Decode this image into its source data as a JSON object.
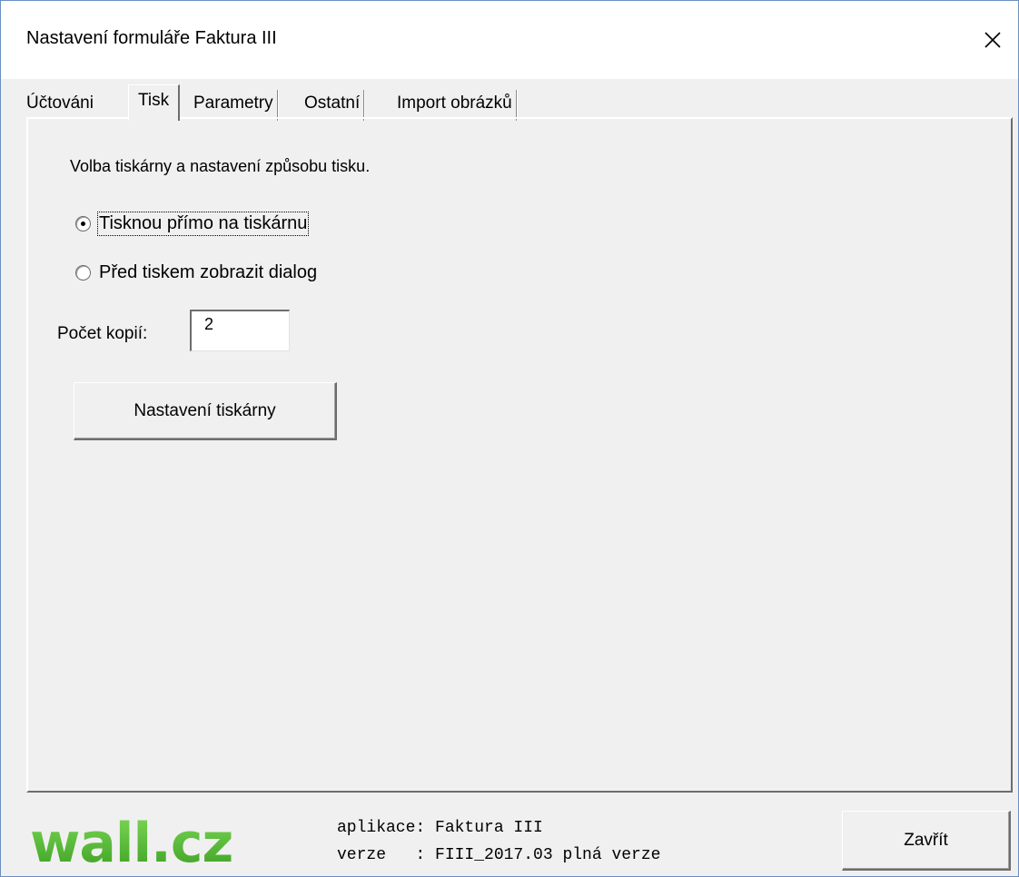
{
  "window": {
    "title": "Nastavení formuláře Faktura III"
  },
  "tabs": [
    {
      "label": "Účtováni",
      "active": false
    },
    {
      "label": "Tisk",
      "active": true
    },
    {
      "label": "Parametry",
      "active": false
    },
    {
      "label": "Ostatní",
      "active": false
    },
    {
      "label": "Import obrázků",
      "active": false
    }
  ],
  "print": {
    "description": "Volba tiskárny a nastavení způsobu tisku.",
    "option_direct": "Tisknou přímo na tiskárnu",
    "option_dialog": "Před tiskem zobrazit dialog",
    "selected_option": "direct",
    "copies_label": "Počet kopií:",
    "copies_value": "2",
    "printer_settings_button": "Nastavení tiskárny"
  },
  "footer": {
    "logo_text": "wall.cz",
    "app_line": "aplikace: Faktura III",
    "version_line": "verze   : FIII_2017.03 plná verze",
    "close_button": "Zavřít"
  },
  "colors": {
    "logo_green": "#4bb82f",
    "dialog_bg": "#f0f0f0",
    "window_border": "#6a8fc0"
  }
}
